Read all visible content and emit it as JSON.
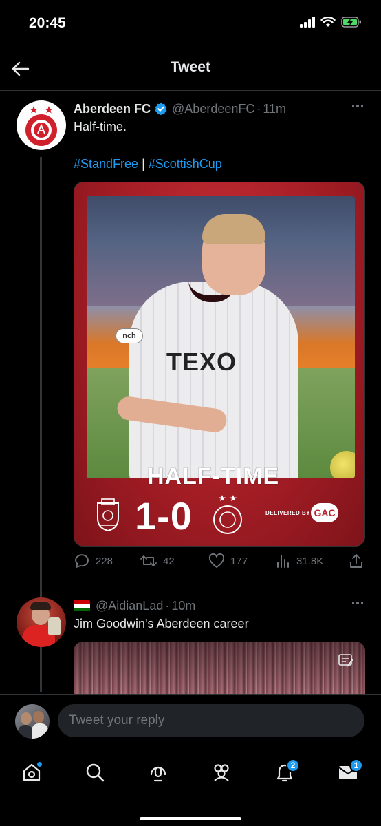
{
  "status_bar": {
    "time": "20:45"
  },
  "header": {
    "title": "Tweet",
    "back_icon": "arrow-left-icon"
  },
  "tweet": {
    "author_name": "Aberdeen FC",
    "handle": "@AberdeenFC",
    "separator": "·",
    "time": "11m",
    "text": "Half-time.",
    "hashtag_1": "#StandFree",
    "hashtag_sep": " | ",
    "hashtag_2": "#ScottishCup",
    "media": {
      "sponsor_text": "TEXO",
      "patch_text": "nch",
      "banner_part1": "HALF",
      "banner_part2": "-TIME",
      "score": "1-0",
      "delivered_by": "DELIVERED BY",
      "sponsor_logo": "GAC"
    },
    "stats": {
      "replies": "228",
      "retweets": "42",
      "likes": "177",
      "views": "31.8K"
    }
  },
  "reply": {
    "handle": "@AidianLad",
    "separator": "·",
    "time": "10m",
    "text": "Jim Goodwin's Aberdeen career"
  },
  "composer": {
    "placeholder": "Tweet your reply"
  },
  "bottom_nav": {
    "items": [
      {
        "icon": "home-icon"
      },
      {
        "icon": "search-icon"
      },
      {
        "icon": "spaces-icon"
      },
      {
        "icon": "communities-icon"
      },
      {
        "icon": "notifications-icon",
        "badge": "2"
      },
      {
        "icon": "messages-icon",
        "badge": "1"
      }
    ]
  },
  "colors": {
    "accent": "#1d9bf0",
    "background": "#000000",
    "text": "#e7e9ea",
    "muted": "#71767b",
    "club_red": "#b7232c"
  }
}
